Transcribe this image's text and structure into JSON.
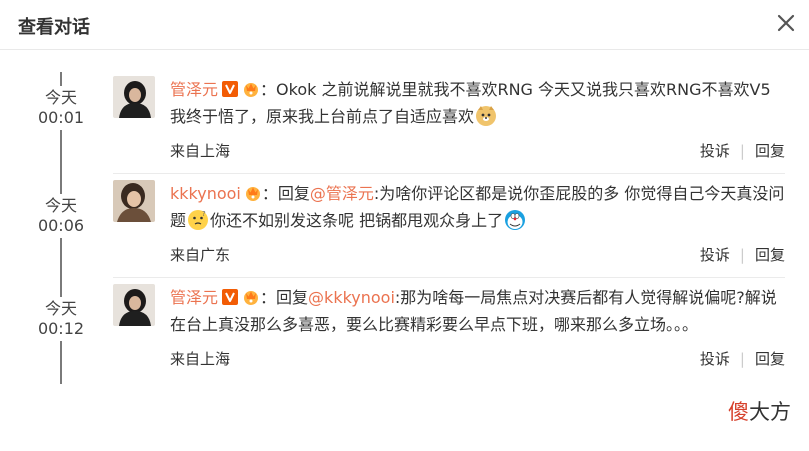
{
  "dialog": {
    "title": "查看对话"
  },
  "icons": {
    "close": "close-icon",
    "verified": "verified-v-icon",
    "vip": "vip-crown-icon",
    "emoji_doge": "doge-emoji-icon",
    "emoji_thinking": "thinking-emoji-icon",
    "emoji_doraemon": "doraemon-emoji-icon"
  },
  "colors": {
    "username": "#eb7350",
    "verified_badge": "#f25c05",
    "watermark_accent": "#d6402b"
  },
  "comments": [
    {
      "day": "今天",
      "time": "00:01",
      "username": "管泽元",
      "colon": "：",
      "reply_prefix": "",
      "mention": "",
      "text_a": "Okok 之前说解说里就我不喜欢RNG 今天又说我只喜欢RNG不喜欢V5 我终于悟了，原来我上台前点了自适应喜欢",
      "text_b": "",
      "location": "来自上海",
      "report": "投诉",
      "reply": "回复"
    },
    {
      "day": "今天",
      "time": "00:06",
      "username": "kkkynooi",
      "colon": "：",
      "reply_prefix": "回复",
      "mention": "@管泽元",
      "text_a": ":为啥你评论区都是说你歪屁股的多 你觉得自己今天真没问题",
      "text_b": "你还不如别发这条呢 把锅都甩观众身上了",
      "location": "来自广东",
      "report": "投诉",
      "reply": "回复"
    },
    {
      "day": "今天",
      "time": "00:12",
      "username": "管泽元",
      "colon": "：",
      "reply_prefix": "回复",
      "mention": "@kkkynooi",
      "text_a": ":那为啥每一局焦点对决赛后都有人觉得解说偏呢?解说在台上真没那么多喜恶，要么比赛精彩要么早点下班，哪来那么多立场。。。",
      "text_b": "",
      "location": "来自上海",
      "report": "投诉",
      "reply": "回复"
    }
  ],
  "watermark": {
    "first": "傻",
    "rest": "大方"
  }
}
